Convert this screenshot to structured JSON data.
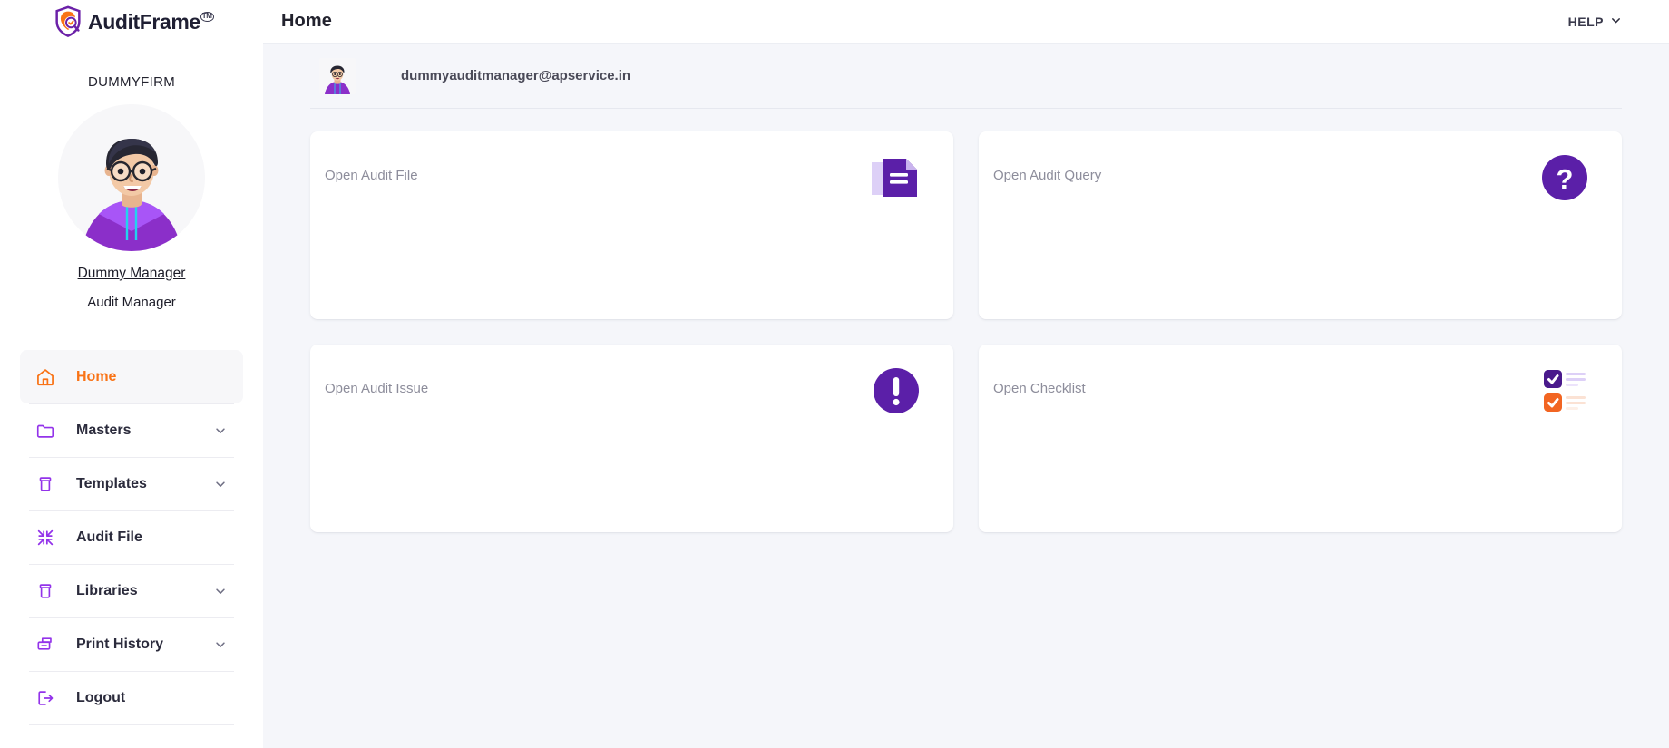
{
  "brand": {
    "name": "AuditFrame",
    "trademark": "TM",
    "logo_icon": "shield-magnifier-logo",
    "purple": "#6b21a8",
    "orange": "#f97316"
  },
  "sidebar": {
    "firm_name": "DUMMYFIRM",
    "avatar_icon": "user-avatar-illustration",
    "user_name": "Dummy Manager",
    "user_role": "Audit Manager",
    "items": [
      {
        "label": "Home",
        "icon": "home-icon",
        "active": true,
        "has_caret": false
      },
      {
        "label": "Masters",
        "icon": "folder-icon",
        "active": false,
        "has_caret": true
      },
      {
        "label": "Templates",
        "icon": "box-icon",
        "active": false,
        "has_caret": true
      },
      {
        "label": "Audit File",
        "icon": "collapse-icon",
        "active": false,
        "has_caret": false
      },
      {
        "label": "Libraries",
        "icon": "box-icon",
        "active": false,
        "has_caret": true
      },
      {
        "label": "Print History",
        "icon": "printer-icon",
        "active": false,
        "has_caret": true
      },
      {
        "label": "Logout",
        "icon": "logout-icon",
        "active": false,
        "has_caret": false
      }
    ]
  },
  "topbar": {
    "title": "Home",
    "help_label": "HELP",
    "help_caret_icon": "chevron-down-icon"
  },
  "user_row": {
    "avatar_icon": "user-avatar-small",
    "email": "dummyauditmanager@apservice.in"
  },
  "cards": [
    {
      "label": "Open Audit File",
      "icon": "document-icon"
    },
    {
      "label": "Open Audit Query",
      "icon": "question-mark-circle-icon"
    },
    {
      "label": "Open Audit Issue",
      "icon": "exclamation-circle-icon"
    },
    {
      "label": "Open Checklist",
      "icon": "checklist-icon"
    }
  ]
}
